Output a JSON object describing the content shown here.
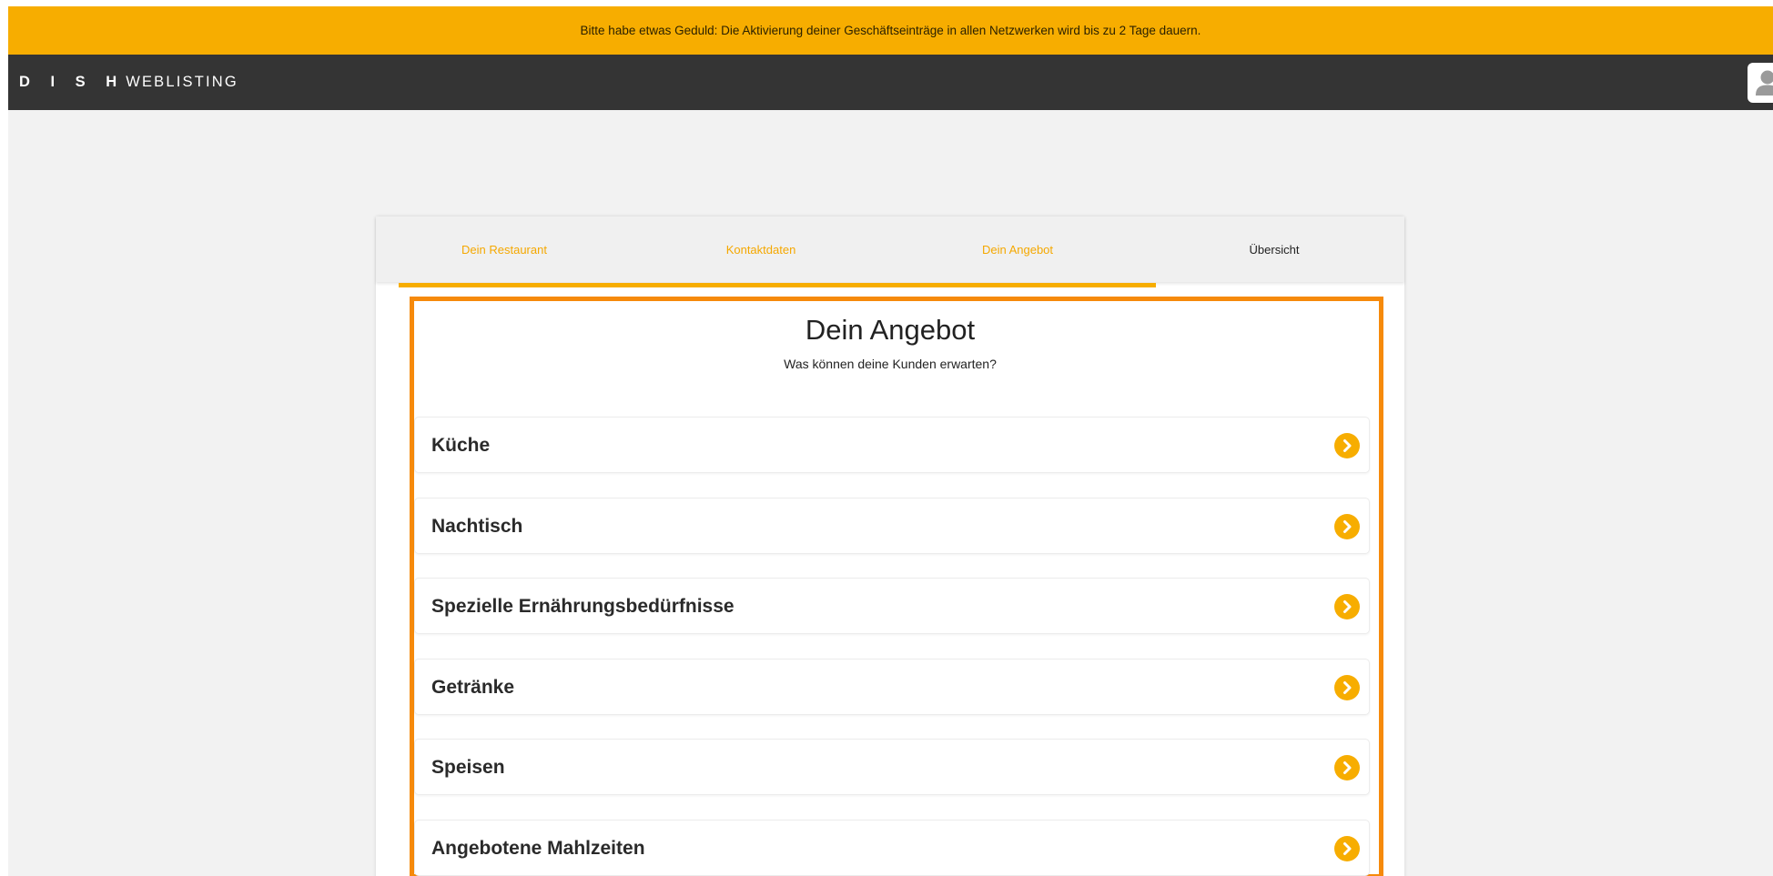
{
  "banner": {
    "text": "Bitte habe etwas Geduld: Die Aktivierung deiner Geschäftseinträge in allen Netzwerken wird bis zu 2 Tage dauern.",
    "color": "#f7ad00"
  },
  "header": {
    "brand_bold": "D I S H",
    "brand_light": "WEBLISTING",
    "avatar_icon": "user-icon"
  },
  "wizard": {
    "tabs": [
      {
        "label": "Dein Restaurant",
        "state": "done"
      },
      {
        "label": "Kontaktdaten",
        "state": "done"
      },
      {
        "label": "Dein Angebot",
        "state": "done"
      },
      {
        "label": "Übersicht",
        "state": "current"
      }
    ],
    "progress_fraction": 0.77,
    "accent_color": "#f7ad00",
    "highlight_color": "#f68a0b"
  },
  "section": {
    "title": "Dein Angebot",
    "subtitle": "Was können deine Kunden erwarten?"
  },
  "categories": [
    {
      "label": "Küche",
      "icon": "chevron-right-circle-icon"
    },
    {
      "label": "Nachtisch",
      "icon": "chevron-right-circle-icon"
    },
    {
      "label": "Spezielle Ernährungsbedürfnisse",
      "icon": "chevron-right-circle-icon"
    },
    {
      "label": "Getränke",
      "icon": "chevron-right-circle-icon"
    },
    {
      "label": "Speisen",
      "icon": "chevron-right-circle-icon"
    },
    {
      "label": "Angebotene Mahlzeiten",
      "icon": "chevron-right-circle-icon"
    }
  ]
}
